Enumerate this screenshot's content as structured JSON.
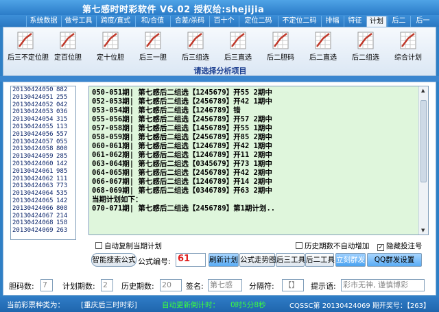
{
  "window": {
    "title": "第七感时时彩软件  V6.02  授权给:shejijia"
  },
  "tabs": [
    {
      "label": "系统数据"
    },
    {
      "label": "做号工具"
    },
    {
      "label": "跨度/直式"
    },
    {
      "label": "和/合值"
    },
    {
      "label": "合差/杀码"
    },
    {
      "label": "百十个"
    },
    {
      "label": "定位二码"
    },
    {
      "label": "不定位二码"
    },
    {
      "label": "排幅"
    },
    {
      "label": "特征"
    },
    {
      "label": "计划"
    },
    {
      "label": "后二"
    },
    {
      "label": "后一"
    }
  ],
  "active_tab": "计划",
  "ribbon": {
    "buttons": [
      {
        "label": "后三不定位胆"
      },
      {
        "label": "定百位胆"
      },
      {
        "label": "定十位胆"
      },
      {
        "label": "后三一胆"
      },
      {
        "label": "后三组选"
      },
      {
        "label": "后三直选"
      },
      {
        "label": "后二胆码"
      },
      {
        "label": "后二直选"
      },
      {
        "label": "后二组选"
      },
      {
        "label": "综合计划"
      }
    ],
    "group_label": "请选择分析项目",
    "icon_color": "#c0392b"
  },
  "draws": [
    {
      "period": "20130424050",
      "number": "882"
    },
    {
      "period": "20130424051",
      "number": "255"
    },
    {
      "period": "20130424052",
      "number": "042"
    },
    {
      "period": "20130424053",
      "number": "036"
    },
    {
      "period": "20130424054",
      "number": "315"
    },
    {
      "period": "20130424055",
      "number": "113"
    },
    {
      "period": "20130424056",
      "number": "557"
    },
    {
      "period": "20130424057",
      "number": "055"
    },
    {
      "period": "20130424058",
      "number": "800"
    },
    {
      "period": "20130424059",
      "number": "285"
    },
    {
      "period": "20130424060",
      "number": "142"
    },
    {
      "period": "20130424061",
      "number": "985"
    },
    {
      "period": "20130424062",
      "number": "111"
    },
    {
      "period": "20130424063",
      "number": "773"
    },
    {
      "period": "20130424064",
      "number": "535"
    },
    {
      "period": "20130424065",
      "number": "142"
    },
    {
      "period": "20130424066",
      "number": "808"
    },
    {
      "period": "20130424067",
      "number": "214"
    },
    {
      "period": "20130424068",
      "number": "158"
    },
    {
      "period": "20130424069",
      "number": "263"
    }
  ],
  "plan_log": [
    "050-051期| 第七感后二组选【1245679】开55 2期中",
    "052-053期| 第七感后二组选【2456789】开42 1期中",
    "053-054期| 第七感后二组选【1246789】错",
    "055-056期| 第七感后二组选【2456789】开57 2期中",
    "057-058期| 第七感后二组选【1456789】开55 1期中",
    "058-059期| 第七感后二组选【2456789】开85 2期中",
    "060-061期| 第七感后二组选【1246789】开42 1期中",
    "061-062期| 第七感后二组选【1246789】开11 2期中",
    "063-064期| 第七感后二组选【0345679】开73 1期中",
    "064-065期| 第七感后二组选【2456789】开42 2期中",
    "066-067期| 第七感后二组选【1246789】开14 2期中",
    "068-069期| 第七感后二组选【0346789】开63 2期中",
    "当期计划如下：",
    "070-071期| 第七感后二组选【2456789】第1期计划.."
  ],
  "options": {
    "auto_copy_label": "自动复制当期计划",
    "history_label": "历史期数不自动增加",
    "hide_label": "隐藏投注号"
  },
  "actions": {
    "smart_search": "智能搜索公式",
    "formula_label": "公式编号:",
    "formula_value": "61",
    "refresh_plan": "刷新计划",
    "formula_trend": "公式走势图",
    "tool_3": "后三工具",
    "tool_2": "后二工具",
    "group_send": "立刻群发",
    "qq_settings": "QQ群发设置"
  },
  "settings": {
    "bile_count_label": "胆码数:",
    "bile_count_value": "7",
    "plan_periods_label": "计划期数:",
    "plan_periods_value": "2",
    "history_periods_label": "历史期数:",
    "history_periods_value": "20",
    "signature_label": "签名:",
    "signature_value": "第七感",
    "separator_label": "分隔符:",
    "separator_value": "【】",
    "hint_label": "提示语:",
    "hint_value": "彩市无神, 谨慎博彩"
  },
  "status": {
    "lottery_type_label": "当前彩票种类为：",
    "lottery_type_value": "[重庆后三时时彩]",
    "countdown_label": "自动更新倒计时：",
    "countdown_value": "0时5分8秒",
    "latest": "CQSSC第 20130424069 期开奖号：【263】"
  }
}
